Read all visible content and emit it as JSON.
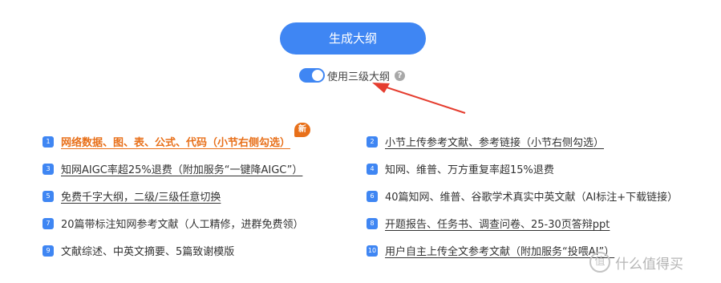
{
  "generate_button": "生成大纲",
  "toggle": {
    "label": "使用三级大纲",
    "on": true,
    "help": "?"
  },
  "badge": "新",
  "items": [
    {
      "num": "1",
      "text": "网络数据、图、表、公式、代码（小节右侧勾选）"
    },
    {
      "num": "2",
      "text": "小节上传参考文献、参考链接（小节右侧勾选）"
    },
    {
      "num": "3",
      "text": "知网AIGC率超25%退费（附加服务“一键降AIGC”）"
    },
    {
      "num": "4",
      "text": "知网、维普、万方重复率超15%退费"
    },
    {
      "num": "5",
      "text": "免费千字大纲，二级/三级任意切换"
    },
    {
      "num": "6",
      "text": "40篇知网、维普、谷歌学术真实中英文献（AI标注+下载链接）"
    },
    {
      "num": "7",
      "text": "20篇带标注知网参考文献（人工精修，进群免费领）"
    },
    {
      "num": "8",
      "text": "开题报告、任务书、调查问卷、25-30页答辩ppt"
    },
    {
      "num": "9",
      "text": "文献综述、中英文摘要、5篇致谢模版"
    },
    {
      "num": "10",
      "text": "用户自主上传全文参考文献（附加服务“投喂AI”）"
    }
  ],
  "watermark": {
    "logo": "值",
    "text": "什么值得买"
  },
  "colors": {
    "accent": "#3f86f3",
    "highlight": "#e8701a",
    "arrow": "#e53c2e"
  }
}
